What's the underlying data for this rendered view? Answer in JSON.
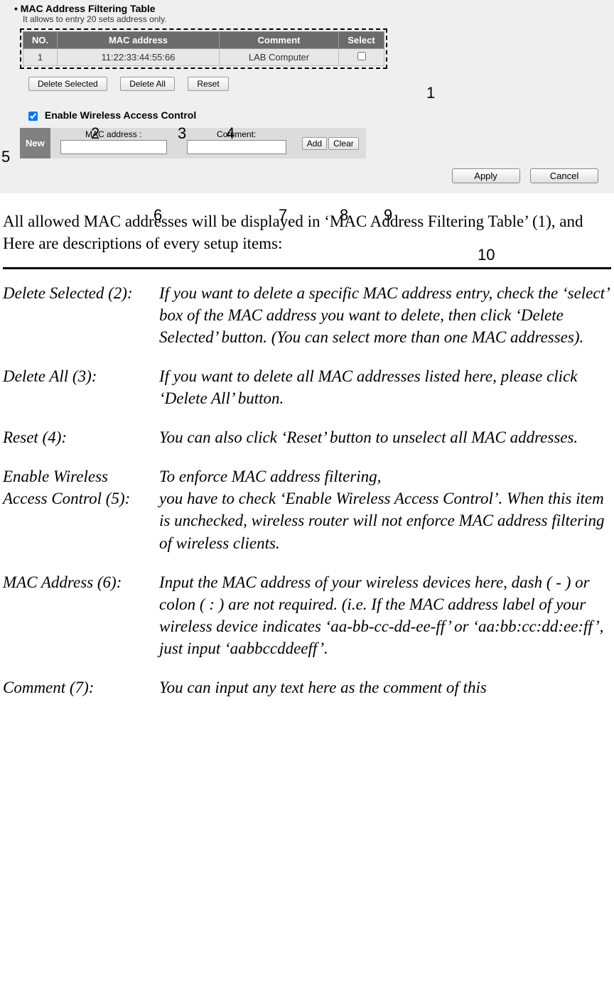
{
  "screenshot": {
    "title": "MAC Address Filtering Table",
    "subtitle": "It allows to entry 20 sets address only.",
    "headers": {
      "no": "NO.",
      "mac": "MAC address",
      "comment": "Comment",
      "select": "Select"
    },
    "row": {
      "no": "1",
      "mac": "11:22:33:44:55:66",
      "comment": "LAB Computer"
    },
    "buttons": {
      "delete_selected": "Delete Selected",
      "delete_all": "Delete All",
      "reset": "Reset"
    },
    "enable_label": "Enable Wireless Access Control",
    "new_label": "New",
    "new_mac_label": "MAC address :",
    "new_comment_label": "Comment:",
    "add": "Add",
    "clear": "Clear",
    "apply": "Apply",
    "cancel": "Cancel"
  },
  "annotations": {
    "a1": "1",
    "a2": "2",
    "a3": "3",
    "a4": "4",
    "a5": "5",
    "a6": "6",
    "a7": "7",
    "a8": "8",
    "a9": "9",
    "a10": "10"
  },
  "body_text": "All allowed MAC addresses will be displayed in ‘MAC Address Filtering Table’ (1), and Here are descriptions of every setup items:",
  "descriptions": [
    {
      "term": "Delete Selected (2):",
      "text": "If you want to delete a specific MAC address entry, check the ‘select’ box of the MAC address you want to delete, then click ‘Delete Selected’ button. (You can select more than one MAC addresses)."
    },
    {
      "term": "Delete All (3):",
      "text": "If you want to delete all MAC addresses listed here, please click ‘Delete All’ button."
    },
    {
      "term": "Reset (4):",
      "text": "You can also click ‘Reset’ button to unselect all MAC addresses."
    },
    {
      "term": "Enable Wireless Access Control (5):",
      "text": "To enforce MAC address filtering,\nyou have to check ‘Enable Wireless Access Control’. When this item is unchecked, wireless router will not enforce MAC address filtering of wireless clients."
    },
    {
      "term": "MAC Address (6):",
      "text": "Input the MAC address of your wireless devices here, dash ( - ) or colon ( : ) are not required. (i.e. If the MAC address label of your wireless device indicates ‘aa-bb-cc-dd-ee-ff’ or ‘aa:bb:cc:dd:ee:ff’, just input ‘aabbccddeeff’."
    },
    {
      "term": "Comment (7):",
      "text": "You can input any text here as the comment of this"
    }
  ]
}
